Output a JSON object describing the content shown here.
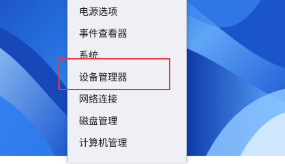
{
  "menu": {
    "items": [
      {
        "label": "电源选项"
      },
      {
        "label": "事件查看器"
      },
      {
        "label": "系统"
      },
      {
        "label": "设备管理器"
      },
      {
        "label": "网络连接"
      },
      {
        "label": "磁盘管理"
      },
      {
        "label": "计算机管理"
      }
    ]
  },
  "annotation": {
    "highlight_color": "#e53935",
    "highlighted_item": "设备管理器"
  },
  "colors": {
    "menu_background": "#eef0f6",
    "wallpaper_blue": "#2a78e6"
  }
}
